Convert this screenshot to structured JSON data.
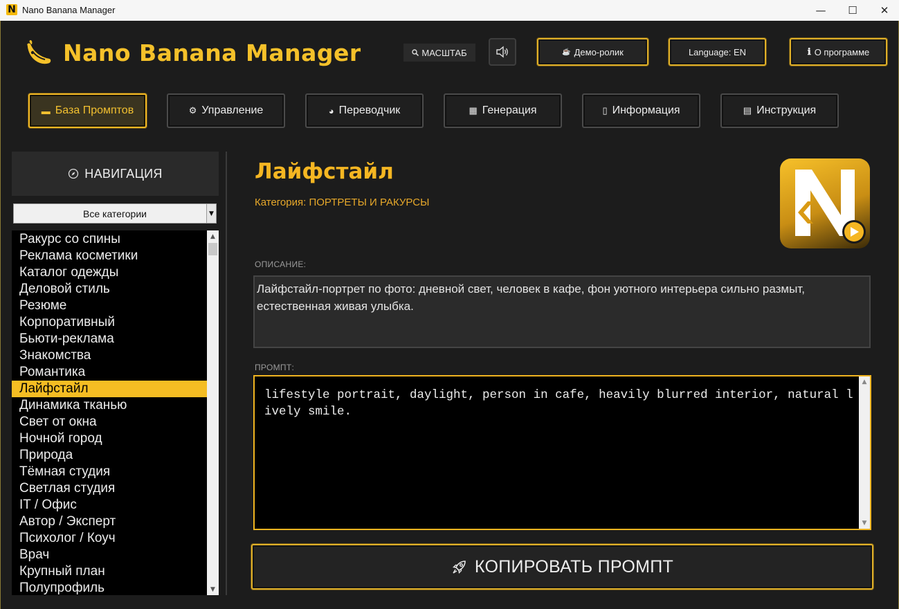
{
  "window": {
    "title": "Nano Banana Manager",
    "icon_letter": "N",
    "controls": {
      "minimize": "—",
      "maximize": "☐",
      "close": "✕"
    }
  },
  "header": {
    "logo_icon": "banana-icon",
    "app_name": "Nano Banana Manager",
    "scale_label": "МАСШТАБ",
    "sound_icon": "speaker-icon",
    "demo_label": "Демо-ролик",
    "language_label": "Language: EN",
    "about_label": "О программе",
    "about_icon_glyph": "ℹ"
  },
  "tabs": [
    {
      "label": "База Промптов",
      "icon": "laptop-icon",
      "glyph": "▬",
      "active": true
    },
    {
      "label": "Управление",
      "icon": "gear-icon",
      "glyph": "⚙",
      "active": false
    },
    {
      "label": "Переводчик",
      "icon": "globe-icon",
      "glyph": "◕",
      "active": false
    },
    {
      "label": "Генерация",
      "icon": "clapperboard-icon",
      "glyph": "▦",
      "active": false
    },
    {
      "label": "Информация",
      "icon": "book-icon",
      "glyph": "▯",
      "active": false
    },
    {
      "label": "Инструкция",
      "icon": "memo-icon",
      "glyph": "▤",
      "active": false
    }
  ],
  "nav": {
    "header": "НАВИГАЦИЯ",
    "header_icon": "compass-icon",
    "category_filter": "Все категории",
    "items": [
      "Ракурс со спины",
      "Реклама косметики",
      "Каталог одежды",
      "Деловой стиль",
      "Резюме",
      "Корпоративный",
      "Бьюти-реклама",
      "Знакомства",
      "Романтика",
      "Лайфстайл",
      "Динамика тканью",
      "Свет от окна",
      "Ночной город",
      "Природа",
      "Тёмная студия",
      "Светлая студия",
      "IT / Офис",
      "Автор / Эксперт",
      "Психолог / Коуч",
      "Врач",
      "Крупный план",
      "Полупрофиль"
    ],
    "selected_index": 9
  },
  "detail": {
    "title": "Лайфстайл",
    "category": "Категория: ПОРТРЕТЫ И РАКУРСЫ",
    "description_label": "ОПИСАНИЕ:",
    "description": "Лайфстайл-портрет по фото: дневной свет, человек в кафе, фон уютного интерьера сильно размыт, естественная живая улыбка.",
    "prompt_label": "ПРОМПТ:",
    "prompt": "lifestyle portrait, daylight, person in cafe, heavily blurred interior, natural lively smile.",
    "copy_label": "КОПИРОВАТЬ ПРОМПТ",
    "copy_icon": "rocket-icon"
  },
  "colors": {
    "accent": "#f5bd23",
    "background": "#1c1c1c",
    "panel": "#2a2a2a",
    "text": "#ececec"
  }
}
